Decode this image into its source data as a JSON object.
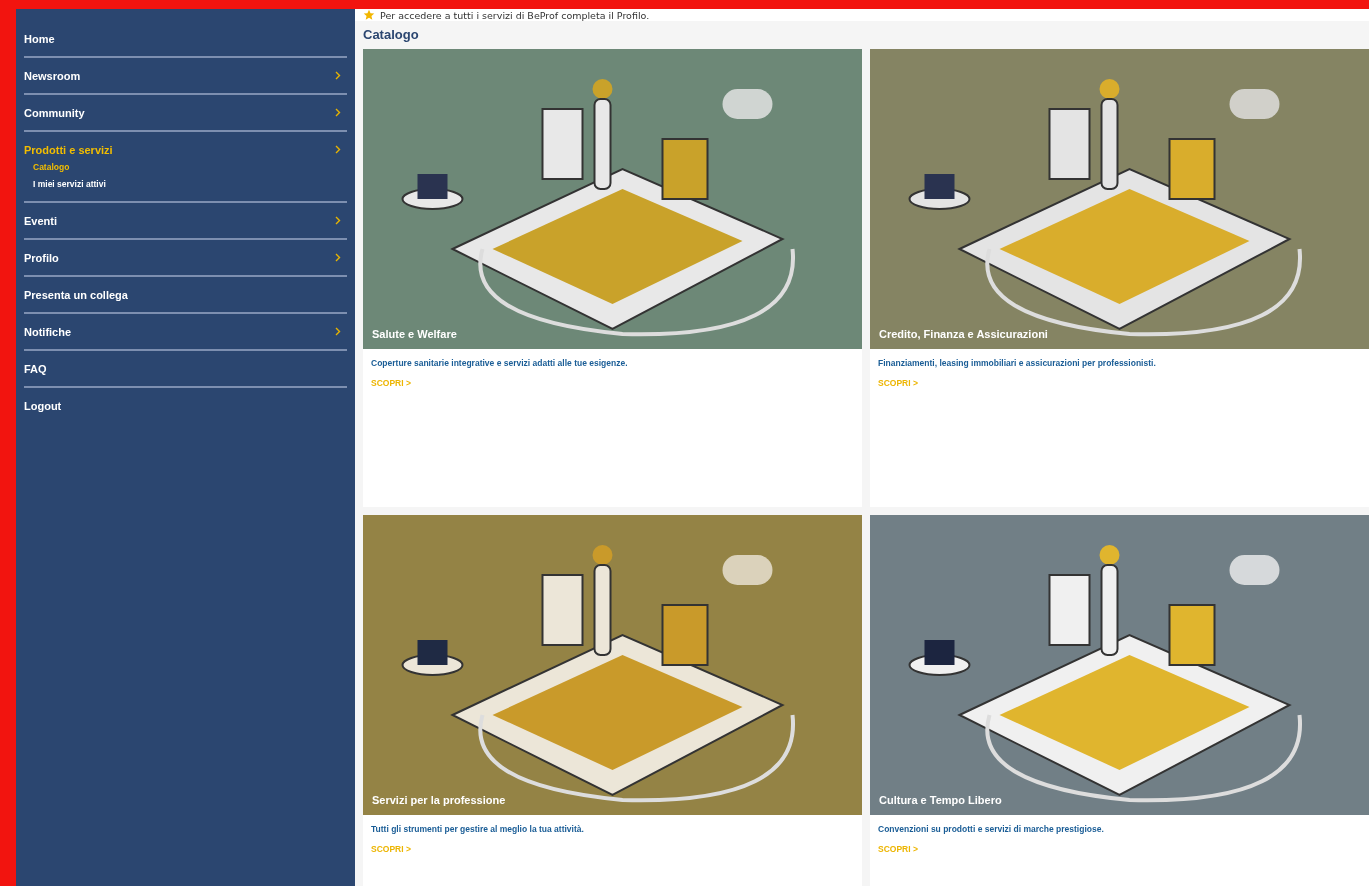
{
  "sidebar": {
    "items": [
      {
        "label": "Home",
        "has_submenu": false,
        "selected": false
      },
      {
        "label": "Newsroom",
        "has_submenu": true,
        "selected": false
      },
      {
        "label": "Community",
        "has_submenu": true,
        "selected": false
      },
      {
        "label": "Prodotti e servizi",
        "has_submenu": true,
        "selected": true,
        "children": [
          {
            "label": "Catalogo",
            "selected": true
          },
          {
            "label": "I miei servizi attivi",
            "selected": false
          }
        ]
      },
      {
        "label": "Eventi",
        "has_submenu": true,
        "selected": false
      },
      {
        "label": "Profilo",
        "has_submenu": true,
        "selected": false
      },
      {
        "label": "Presenta un collega",
        "has_submenu": false,
        "selected": false
      },
      {
        "label": "Notifiche",
        "has_submenu": true,
        "selected": false
      },
      {
        "label": "FAQ",
        "has_submenu": false,
        "selected": false
      },
      {
        "label": "Logout",
        "has_submenu": false,
        "selected": false
      }
    ]
  },
  "notice": {
    "text": "Per accedere a tutti i servizi di BeProf completa il Profilo."
  },
  "catalog": {
    "title": "Catalogo",
    "cards": [
      {
        "title": "Salute e Welfare",
        "description": "Coperture sanitarie integrative e servizi adatti alle tue esigenze.",
        "link": "SCOPRI >"
      },
      {
        "title": "Credito, Finanza e Assicurazioni",
        "description": "Finanziamenti, leasing immobiliari e assicurazioni per professionisti.",
        "link": "SCOPRI >"
      },
      {
        "title": "Servizi per la professione",
        "description": "Tutti gli strumenti per gestire al meglio la tua attività.",
        "link": "SCOPRI >"
      },
      {
        "title": "Cultura e Tempo Libero",
        "description": "Convenzioni su prodotti e servizi di marche prestigiose.",
        "link": "SCOPRI >"
      }
    ]
  }
}
